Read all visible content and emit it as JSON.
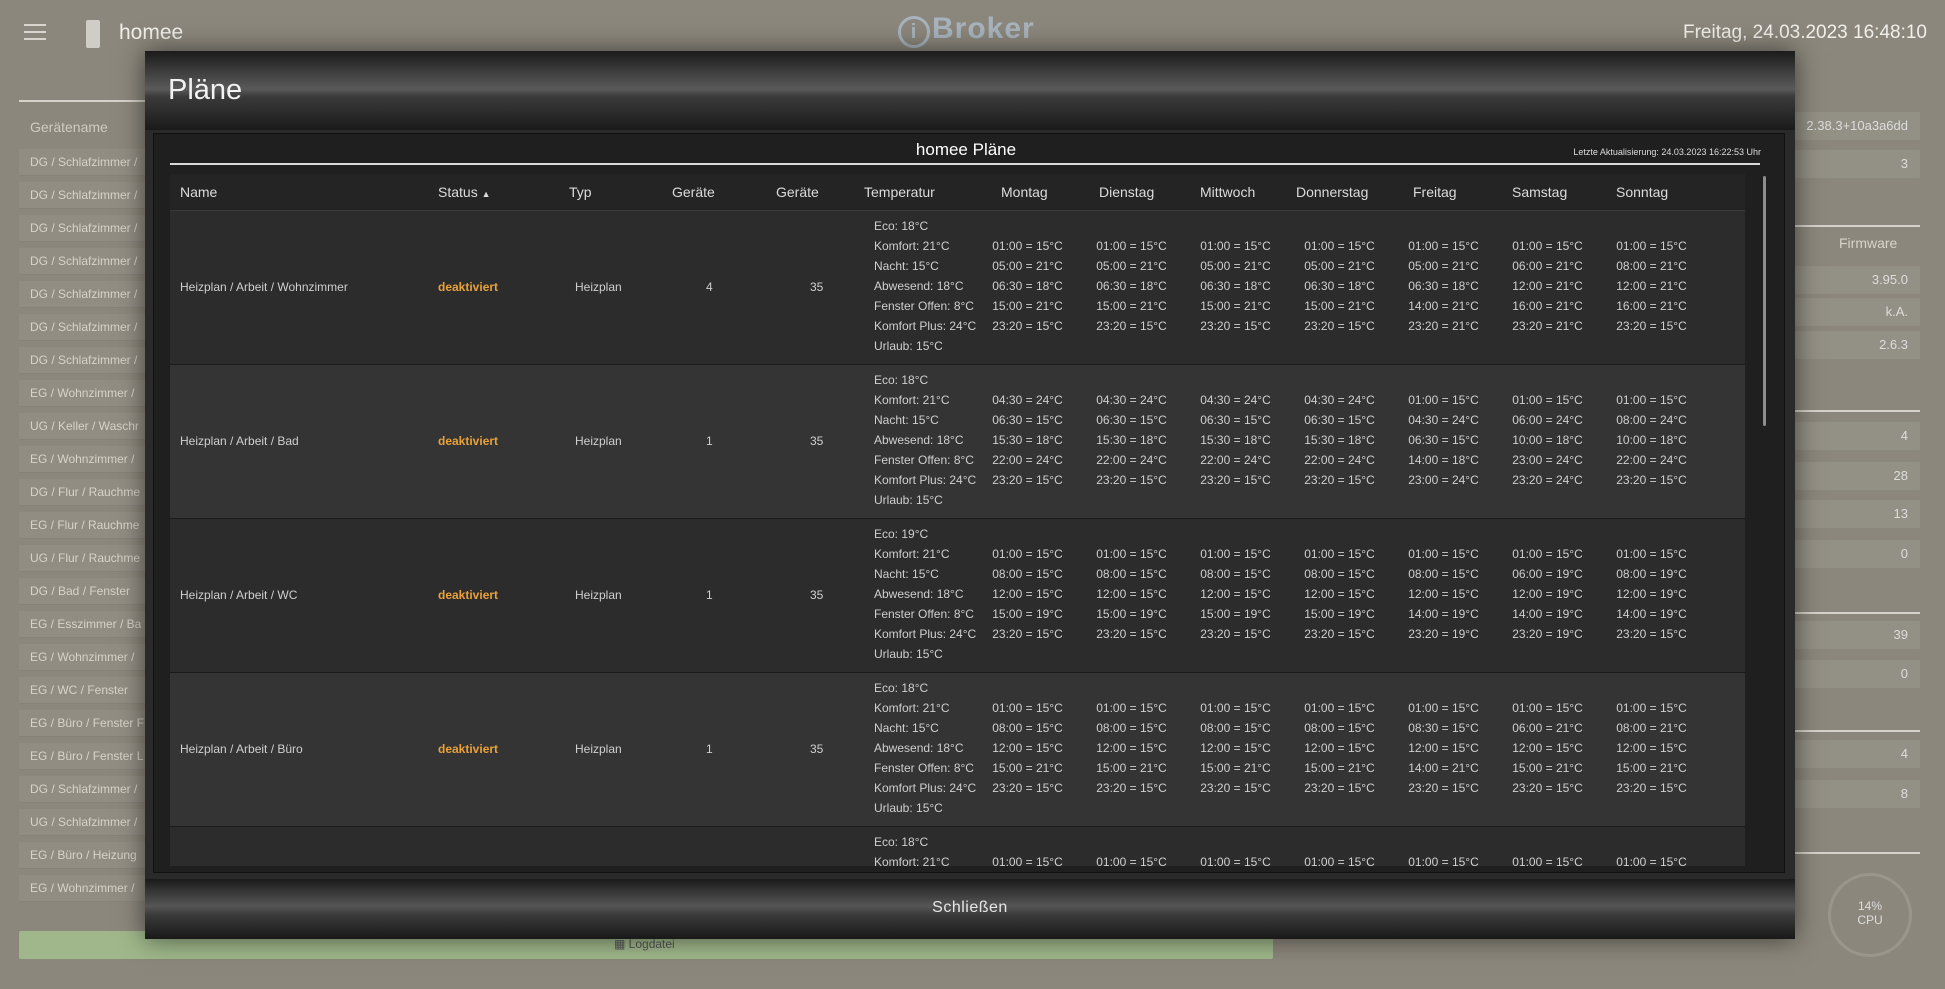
{
  "header": {
    "app_title": "homee",
    "logo_text": "Broker",
    "datetime": "Freitag, 24.03.2023  16:48:10"
  },
  "background": {
    "column_header": "Gerätename",
    "device_rows": [
      "DG / Schlafzimmer /",
      "DG / Schlafzimmer /",
      "DG / Schlafzimmer /",
      "DG / Schlafzimmer /",
      "DG / Schlafzimmer /",
      "DG / Schlafzimmer /",
      "DG / Schlafzimmer /",
      "EG / Wohnzimmer /",
      "UG / Keller / Waschr",
      "EG / Wohnzimmer /",
      "DG / Flur / Rauchme",
      "EG / Flur / Rauchme",
      "UG / Flur / Rauchme",
      "DG / Bad / Fenster",
      "EG / Esszimmer / Ba",
      "EG / Wohnzimmer /",
      "EG / WC / Fenster",
      "EG / Büro / Fenster F",
      "EG / Büro / Fenster L",
      "DG / Schlafzimmer /",
      "UG / Schlafzimmer /",
      "EG / Büro / Heizung",
      "EG / Wohnzimmer /"
    ],
    "log_button_label": "Logdatei",
    "firmware_header": "Firmware",
    "right_values": [
      "2.38.3+10a3a6dd",
      "3",
      "3.95.0",
      "k.A.",
      "2.6.3",
      "4",
      "28",
      "13",
      "0",
      "39",
      "0",
      "4",
      "8"
    ],
    "cpu_value": "14%",
    "cpu_label": "CPU"
  },
  "modal": {
    "title": "Pläne",
    "panel_title": "homee Pläne",
    "last_update": "Letzte Aktualisierung: 24.03.2023 16:22:53 Uhr",
    "close_label": "Schließen",
    "columns": [
      "Name",
      "Status",
      "Typ",
      "Geräte",
      "Geräte",
      "Temperatur",
      "Montag",
      "Dienstag",
      "Mittwoch",
      "Donnerstag",
      "Freitag",
      "Samstag",
      "Sonntag"
    ],
    "sort_indicator": "▲",
    "rows": [
      {
        "name": "Heizplan / Arbeit / Wohnzimmer",
        "status": "deaktiviert",
        "type": "Heizplan",
        "devices1": "4",
        "devices2": "35",
        "temps": [
          "Eco: 18°C",
          "Komfort: 21°C",
          "Nacht: 15°C",
          "Abwesend: 18°C",
          "Fenster Offen: 8°C",
          "Komfort Plus: 24°C",
          "Urlaub: 15°C"
        ],
        "days": [
          [
            "01:00 = 15°C",
            "05:00 = 21°C",
            "06:30 = 18°C",
            "15:00 = 21°C",
            "23:20 = 15°C"
          ],
          [
            "01:00 = 15°C",
            "05:00 = 21°C",
            "06:30 = 18°C",
            "15:00 = 21°C",
            "23:20 = 15°C"
          ],
          [
            "01:00 = 15°C",
            "05:00 = 21°C",
            "06:30 = 18°C",
            "15:00 = 21°C",
            "23:20 = 15°C"
          ],
          [
            "01:00 = 15°C",
            "05:00 = 21°C",
            "06:30 = 18°C",
            "15:00 = 21°C",
            "23:20 = 15°C"
          ],
          [
            "01:00 = 15°C",
            "05:00 = 21°C",
            "06:30 = 18°C",
            "14:00 = 21°C",
            "23:20 = 21°C"
          ],
          [
            "01:00 = 15°C",
            "06:00 = 21°C",
            "12:00 = 21°C",
            "16:00 = 21°C",
            "23:20 = 21°C"
          ],
          [
            "01:00 = 15°C",
            "08:00 = 21°C",
            "12:00 = 21°C",
            "16:00 = 21°C",
            "23:20 = 15°C"
          ]
        ]
      },
      {
        "name": "Heizplan / Arbeit / Bad",
        "status": "deaktiviert",
        "type": "Heizplan",
        "devices1": "1",
        "devices2": "35",
        "temps": [
          "Eco: 18°C",
          "Komfort: 21°C",
          "Nacht: 15°C",
          "Abwesend: 18°C",
          "Fenster Offen: 8°C",
          "Komfort Plus: 24°C",
          "Urlaub: 15°C"
        ],
        "days": [
          [
            "04:30 = 24°C",
            "06:30 = 15°C",
            "15:30 = 18°C",
            "22:00 = 24°C",
            "23:20 = 15°C"
          ],
          [
            "04:30 = 24°C",
            "06:30 = 15°C",
            "15:30 = 18°C",
            "22:00 = 24°C",
            "23:20 = 15°C"
          ],
          [
            "04:30 = 24°C",
            "06:30 = 15°C",
            "15:30 = 18°C",
            "22:00 = 24°C",
            "23:20 = 15°C"
          ],
          [
            "04:30 = 24°C",
            "06:30 = 15°C",
            "15:30 = 18°C",
            "22:00 = 24°C",
            "23:20 = 15°C"
          ],
          [
            "01:00 = 15°C",
            "04:30 = 24°C",
            "06:30 = 15°C",
            "14:00 = 18°C",
            "23:00 = 24°C"
          ],
          [
            "01:00 = 15°C",
            "06:00 = 24°C",
            "10:00 = 18°C",
            "23:00 = 24°C",
            "23:20 = 24°C"
          ],
          [
            "01:00 = 15°C",
            "08:00 = 24°C",
            "10:00 = 18°C",
            "22:00 = 24°C",
            "23:20 = 15°C"
          ]
        ]
      },
      {
        "name": "Heizplan / Arbeit / WC",
        "status": "deaktiviert",
        "type": "Heizplan",
        "devices1": "1",
        "devices2": "35",
        "temps": [
          "Eco: 19°C",
          "Komfort: 21°C",
          "Nacht: 15°C",
          "Abwesend: 18°C",
          "Fenster Offen: 8°C",
          "Komfort Plus: 24°C",
          "Urlaub: 15°C"
        ],
        "days": [
          [
            "01:00 = 15°C",
            "08:00 = 15°C",
            "12:00 = 15°C",
            "15:00 = 19°C",
            "23:20 = 15°C"
          ],
          [
            "01:00 = 15°C",
            "08:00 = 15°C",
            "12:00 = 15°C",
            "15:00 = 19°C",
            "23:20 = 15°C"
          ],
          [
            "01:00 = 15°C",
            "08:00 = 15°C",
            "12:00 = 15°C",
            "15:00 = 19°C",
            "23:20 = 15°C"
          ],
          [
            "01:00 = 15°C",
            "08:00 = 15°C",
            "12:00 = 15°C",
            "15:00 = 19°C",
            "23:20 = 15°C"
          ],
          [
            "01:00 = 15°C",
            "08:00 = 15°C",
            "12:00 = 15°C",
            "14:00 = 19°C",
            "23:20 = 19°C"
          ],
          [
            "01:00 = 15°C",
            "06:00 = 19°C",
            "12:00 = 19°C",
            "14:00 = 19°C",
            "23:20 = 19°C"
          ],
          [
            "01:00 = 15°C",
            "08:00 = 19°C",
            "12:00 = 19°C",
            "14:00 = 19°C",
            "23:20 = 15°C"
          ]
        ]
      },
      {
        "name": "Heizplan / Arbeit / Büro",
        "status": "deaktiviert",
        "type": "Heizplan",
        "devices1": "1",
        "devices2": "35",
        "temps": [
          "Eco: 18°C",
          "Komfort: 21°C",
          "Nacht: 15°C",
          "Abwesend: 18°C",
          "Fenster Offen: 8°C",
          "Komfort Plus: 24°C",
          "Urlaub: 15°C"
        ],
        "days": [
          [
            "01:00 = 15°C",
            "08:00 = 15°C",
            "12:00 = 15°C",
            "15:00 = 21°C",
            "23:20 = 15°C"
          ],
          [
            "01:00 = 15°C",
            "08:00 = 15°C",
            "12:00 = 15°C",
            "15:00 = 21°C",
            "23:20 = 15°C"
          ],
          [
            "01:00 = 15°C",
            "08:00 = 15°C",
            "12:00 = 15°C",
            "15:00 = 21°C",
            "23:20 = 15°C"
          ],
          [
            "01:00 = 15°C",
            "08:00 = 15°C",
            "12:00 = 15°C",
            "15:00 = 21°C",
            "23:20 = 15°C"
          ],
          [
            "01:00 = 15°C",
            "08:30 = 15°C",
            "12:00 = 15°C",
            "14:00 = 21°C",
            "23:20 = 15°C"
          ],
          [
            "01:00 = 15°C",
            "06:00 = 21°C",
            "12:00 = 15°C",
            "15:00 = 21°C",
            "23:20 = 15°C"
          ],
          [
            "01:00 = 15°C",
            "08:00 = 21°C",
            "12:00 = 15°C",
            "15:00 = 21°C",
            "23:20 = 15°C"
          ]
        ]
      },
      {
        "name": "",
        "status": "",
        "type": "",
        "devices1": "",
        "devices2": "",
        "temps": [
          "Eco: 18°C",
          "Komfort: 21°C"
        ],
        "days": [
          [
            "01:00 = 15°C"
          ],
          [
            "01:00 = 15°C"
          ],
          [
            "01:00 = 15°C"
          ],
          [
            "01:00 = 15°C"
          ],
          [
            "01:00 = 15°C"
          ],
          [
            "01:00 = 15°C"
          ],
          [
            "01:00 = 15°C"
          ]
        ]
      }
    ]
  }
}
